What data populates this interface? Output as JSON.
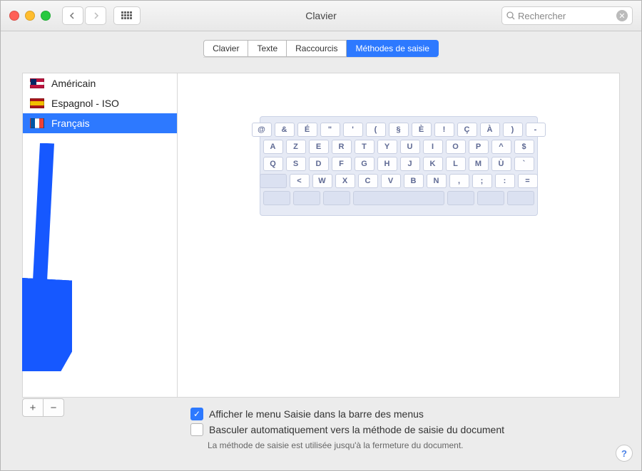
{
  "window": {
    "title": "Clavier"
  },
  "search": {
    "placeholder": "Rechercher"
  },
  "tabs": {
    "items": [
      "Clavier",
      "Texte",
      "Raccourcis",
      "Méthodes de saisie"
    ],
    "active_index": 3
  },
  "input_sources": {
    "items": [
      {
        "label": "Américain",
        "flag": "us",
        "selected": false
      },
      {
        "label": "Espagnol - ISO",
        "flag": "es",
        "selected": false
      },
      {
        "label": "Français",
        "flag": "fr",
        "selected": true
      }
    ]
  },
  "keyboard_preview": {
    "layout_name": "Français",
    "rows": [
      [
        "@",
        "&",
        "É",
        "\"",
        "'",
        "(",
        "§",
        "È",
        "!",
        "Ç",
        "À",
        ")",
        "-"
      ],
      [
        "A",
        "Z",
        "E",
        "R",
        "T",
        "Y",
        "U",
        "I",
        "O",
        "P",
        "^",
        "$"
      ],
      [
        "Q",
        "S",
        "D",
        "F",
        "G",
        "H",
        "J",
        "K",
        "L",
        "M",
        "Ù",
        "`"
      ],
      [
        "<",
        "W",
        "X",
        "C",
        "V",
        "B",
        "N",
        ",",
        ";",
        ":",
        "="
      ]
    ]
  },
  "options": {
    "show_input_menu": {
      "label": "Afficher le menu Saisie dans la barre des menus",
      "checked": true
    },
    "auto_switch": {
      "label": "Basculer automatiquement vers la méthode de saisie du document",
      "checked": false
    },
    "auto_switch_hint": "La méthode de saisie est utilisée jusqu'à la fermeture du document."
  },
  "buttons": {
    "add": "+",
    "remove": "−"
  },
  "help": "?"
}
